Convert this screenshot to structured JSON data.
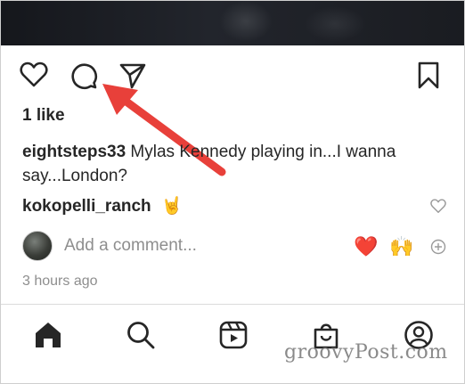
{
  "post": {
    "likes": "1 like",
    "caption_user": "eightsteps33",
    "caption_text": " Mylas Kennedy playing in...I wanna say...London?",
    "comment_user": "kokopelli_ranch",
    "comment_emoji": "🤘",
    "add_comment_placeholder": "Add a comment...",
    "quick_reactions": [
      "❤️",
      "🙌"
    ],
    "timestamp": "3 hours ago"
  },
  "icons": {
    "actions": [
      "heart-icon",
      "comment-icon",
      "share-icon",
      "bookmark-icon"
    ],
    "nav": [
      "home-icon",
      "search-icon",
      "reels-icon",
      "shop-icon",
      "profile-icon"
    ]
  },
  "colors": {
    "arrow": "#e8403a",
    "heart": "#e0245e",
    "text": "#262626",
    "muted": "#8e8e8e"
  },
  "watermark": "groovyPost.com"
}
